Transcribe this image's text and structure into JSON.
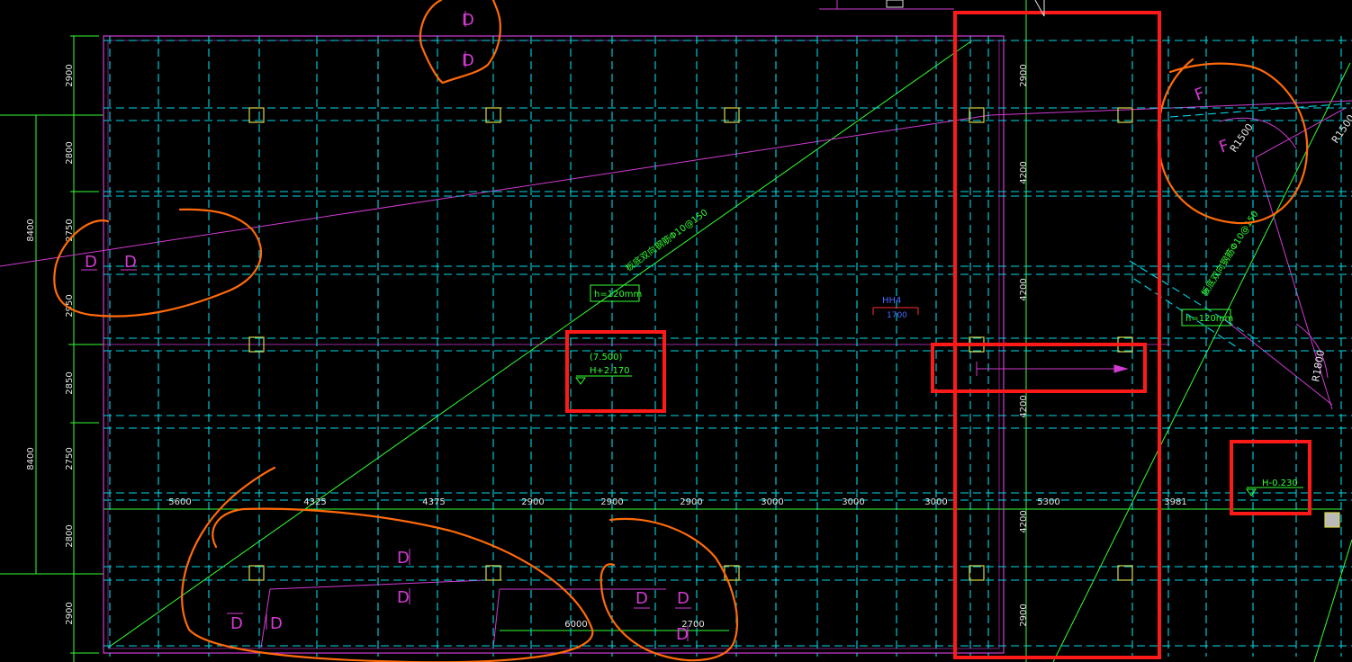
{
  "colors": {
    "background": "#000000",
    "axis": "#d23bd2",
    "beam": "#00d7e6",
    "dim": "#33ff33",
    "annotation_orange": "#ff6a0a",
    "annotation_red": "#ff1a1a",
    "column": "#d9d94a"
  },
  "dims": {
    "left": [
      "2900",
      "2800",
      "8400",
      "2750",
      "2950",
      "2850",
      "8400",
      "2750",
      "2800",
      "2900"
    ],
    "bottom": [
      "5600",
      "4325",
      "4375",
      "2900",
      "2900",
      "2900",
      "3000",
      "3000",
      "3000",
      "5300",
      "3981"
    ],
    "right": [
      "2900",
      "4200",
      "4200",
      "4200",
      "4200",
      "2900"
    ],
    "lower": [
      "6000",
      "2700"
    ]
  },
  "annotations": {
    "slab_h1": "h=120mm",
    "slab_h2": "h=120mm",
    "level_paren": "(7.500)",
    "level_main": "H+2.170",
    "level_right": "H-0.230",
    "rebar_note_1": "板底双向钢筋Φ10@150",
    "rebar_note_2": "板底双向钢筋Φ10@150",
    "hole_tag": "HH4",
    "hole_dim": "1700",
    "radius_1": "R1500",
    "radius_2": "R1500",
    "radius_3": "R1800"
  },
  "section_marks": {
    "top_1": "D",
    "top_2": "D",
    "left_1": "D",
    "left_2": "D",
    "right_1": "F",
    "right_2": "F",
    "bottom_1": "D",
    "bottom_2": "D",
    "bottom_3": "D",
    "bottom_4": "D",
    "bottom_5": "D",
    "bottom_6": "D",
    "bottom_7": "D"
  }
}
